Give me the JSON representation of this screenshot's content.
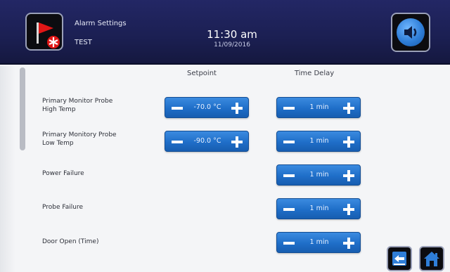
{
  "header": {
    "title": "Alarm Settings",
    "subtitle": "TEST",
    "time": "11:30 am",
    "date": "11/09/2016",
    "icons": {
      "alarm": "alarm-flag-icon",
      "sound": "speaker-icon"
    }
  },
  "columns": {
    "setpoint": "Setpoint",
    "time_delay": "Time Delay"
  },
  "rows": [
    {
      "label_line1": "Primary Monitor Probe",
      "label_line2": "High Temp",
      "setpoint": "-70.0 °C",
      "delay": "1 min"
    },
    {
      "label_line1": "Primary Monitory Probe",
      "label_line2": "Low Temp",
      "setpoint": "-90.0 °C",
      "delay": "1 min"
    },
    {
      "label_line1": "Power Failure",
      "delay": "1 min"
    },
    {
      "label_line1": "Probe Failure",
      "delay": "1 min"
    },
    {
      "label_line1": "Door Open (Time)",
      "delay": "1 min"
    }
  ],
  "nav": {
    "back_icon": "back-arrow-icon",
    "home_icon": "home-icon"
  },
  "colors": {
    "header": "#1f2360",
    "button": "#2a7bd4",
    "background": "#f4f5f7"
  }
}
